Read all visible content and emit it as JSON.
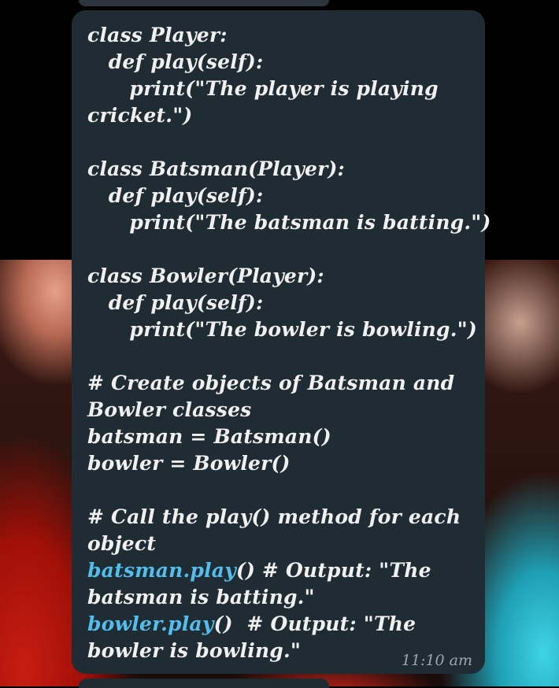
{
  "message": {
    "lines": [
      {
        "text": "class Player:"
      },
      {
        "text": "   def play(self):"
      },
      {
        "text": "      print(\"The player is playing"
      },
      {
        "text": "cricket.\")"
      },
      {
        "text": ""
      },
      {
        "text": "class Batsman(Player):"
      },
      {
        "text": "   def play(self):"
      },
      {
        "text": "      print(\"The batsman is batting.\")"
      },
      {
        "text": ""
      },
      {
        "text": "class Bowler(Player):"
      },
      {
        "text": "   def play(self):"
      },
      {
        "text": "      print(\"The bowler is bowling.\")"
      },
      {
        "text": ""
      },
      {
        "text": "# Create objects of Batsman and"
      },
      {
        "text": "Bowler classes"
      },
      {
        "text": "batsman = Batsman()"
      },
      {
        "text": "bowler = Bowler()"
      },
      {
        "text": ""
      },
      {
        "text": "# Call the play() method for each"
      },
      {
        "text": "object"
      },
      {
        "link": "batsman.play",
        "text": "() # Output: \"The"
      },
      {
        "text": "batsman is batting.\""
      },
      {
        "link": "bowler.play",
        "text": "()  # Output: \"The"
      },
      {
        "text": "bowler is bowling.\""
      }
    ],
    "timestamp": "11:10 am"
  },
  "colors": {
    "bubble": "#1f2c33",
    "link": "#53bdeb",
    "timestamp": "#9aa6ad"
  }
}
